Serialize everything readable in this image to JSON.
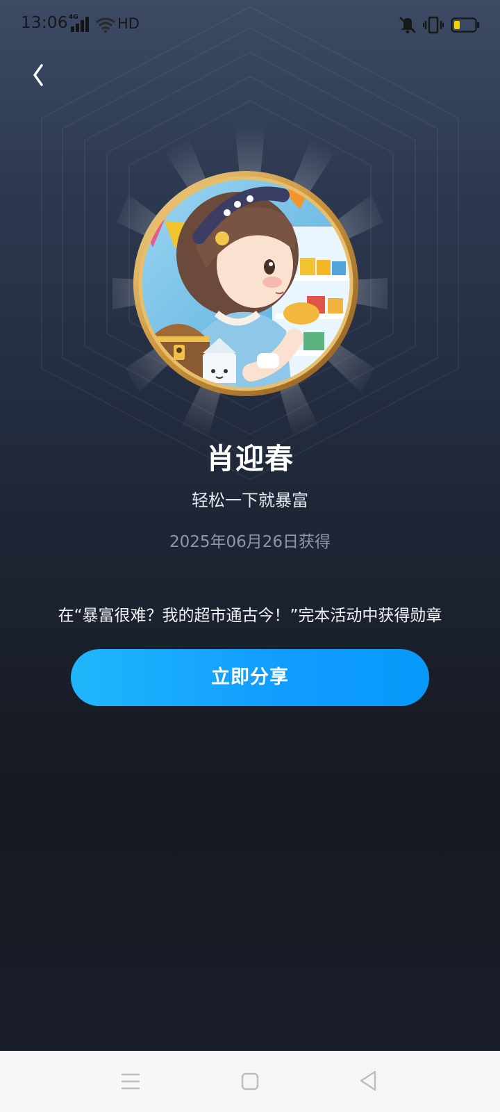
{
  "status_bar": {
    "time": "13:06",
    "network": "4G",
    "hd": "HD",
    "battery_level": 0.2,
    "icons": [
      "signal-icon",
      "wifi-icon",
      "mute-icon",
      "vibrate-icon",
      "battery-icon"
    ]
  },
  "header": {
    "back_icon": "chevron-left-icon"
  },
  "badge": {
    "name": "肖迎春",
    "subtitle": "轻松一下就暴富",
    "obtained_date": "2025年06月26日获得",
    "activity_description": "在“暴富很难？我的超市通古今！”完本活动中获得勋章"
  },
  "actions": {
    "share_label": "立即分享"
  },
  "nav_bar": {
    "icons": [
      "menu-icon",
      "home-icon",
      "back-triangle-icon"
    ]
  },
  "colors": {
    "background_top": "#3c4a64",
    "background_bottom": "#15181f",
    "share_button": "#0f9cff",
    "medal_rim": "#d8a64b",
    "battery_fill": "#f5d000"
  }
}
